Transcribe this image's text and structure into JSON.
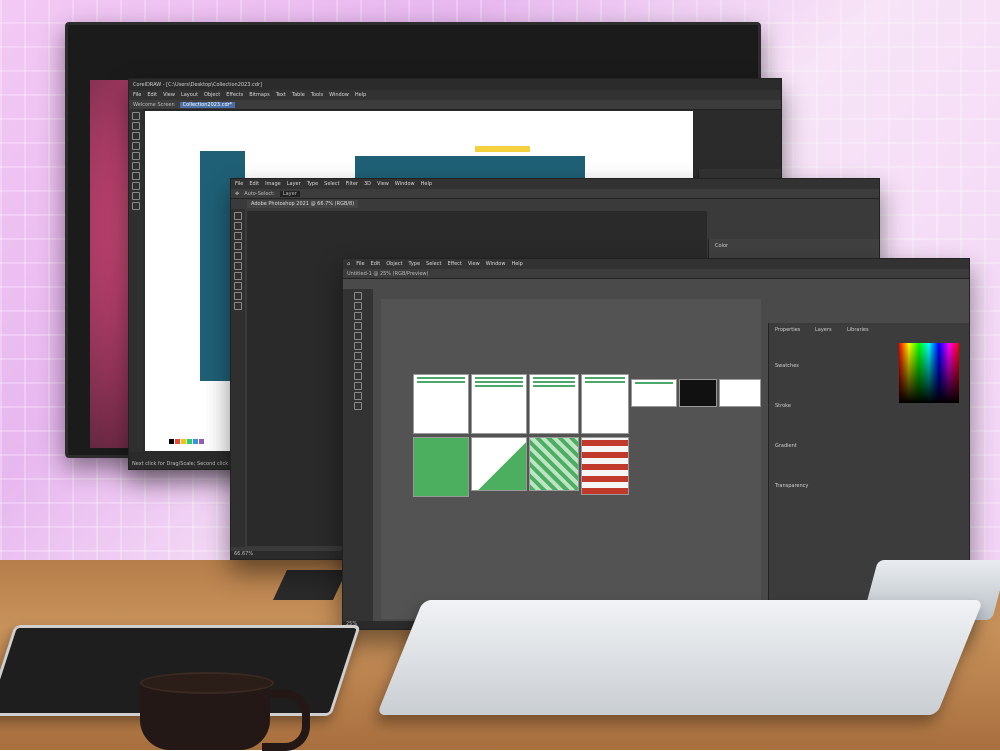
{
  "scene": {
    "colors": {
      "wall": "#f3c9f4",
      "desk": "#b57e4a",
      "app_ui": "#535353",
      "accent_green": "#4cae5f"
    }
  },
  "coreldraw": {
    "title": "CorelDRAW - [C:\\Users\\Desktop\\Collection2023.cdr]",
    "menu": [
      "File",
      "Edit",
      "View",
      "Layout",
      "Object",
      "Effects",
      "Bitmaps",
      "Text",
      "Table",
      "Tools",
      "Window",
      "Help"
    ],
    "tabs": [
      "Welcome Screen",
      "Collection2023.cdr*"
    ],
    "status": "Next click for Drag/Scale; Second click for Rotate/Skew"
  },
  "photoshop_back": {
    "menu": [
      "File",
      "Edit",
      "Image",
      "Layer",
      "Type",
      "Select",
      "Filter",
      "3D",
      "View",
      "Window",
      "Help"
    ],
    "auto_select": "Auto-Select:",
    "layer": "Layer",
    "doc_tab": "Adobe Photoshop 2021 @ 66.7% (RGB/8)",
    "zoom": "66.67%",
    "panel_tab": "Color"
  },
  "photoshop_front": {
    "menu": [
      "File",
      "Edit",
      "Object",
      "Type",
      "Select",
      "Effect",
      "View",
      "Window",
      "Help"
    ],
    "doc_tab": "Untitled-1 @ 25% (RGB/Preview)",
    "zoom": "25%",
    "right_panels": {
      "tabs": [
        "Properties",
        "Layers",
        "Libraries"
      ],
      "section": "Swatches",
      "stroke": "Stroke",
      "gradient": "Gradient",
      "transparency": "Transparency"
    }
  }
}
